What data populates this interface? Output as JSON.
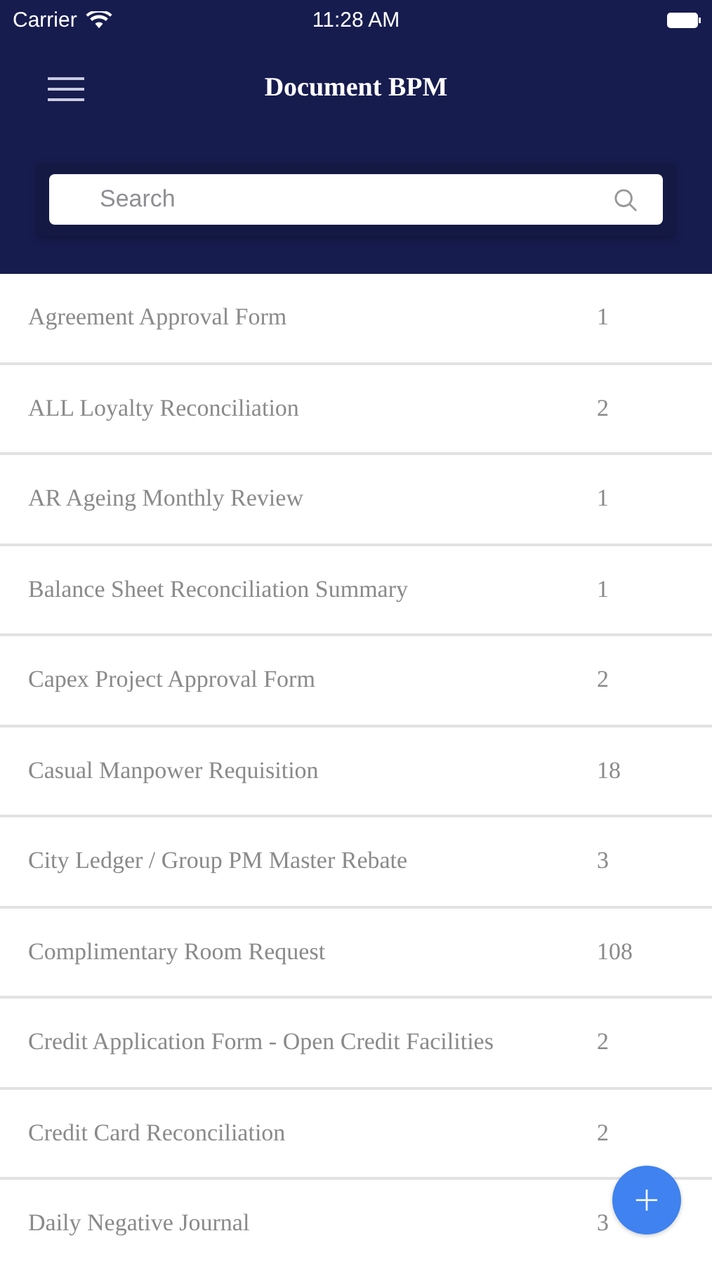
{
  "status_bar": {
    "carrier": "Carrier",
    "time": "11:28 AM"
  },
  "header": {
    "title": "Document BPM"
  },
  "search": {
    "placeholder": "Search"
  },
  "documents": [
    {
      "name": "Agreement Approval Form",
      "count": "1"
    },
    {
      "name": "ALL Loyalty Reconciliation",
      "count": "2"
    },
    {
      "name": "AR Ageing Monthly Review",
      "count": "1"
    },
    {
      "name": "Balance Sheet Reconciliation Summary",
      "count": "1"
    },
    {
      "name": "Capex Project Approval Form",
      "count": "2"
    },
    {
      "name": "Casual Manpower Requisition",
      "count": "18"
    },
    {
      "name": "City Ledger / Group PM Master Rebate",
      "count": "3"
    },
    {
      "name": "Complimentary Room Request",
      "count": "108"
    },
    {
      "name": "Credit Application Form - Open Credit Facilities",
      "count": "2"
    },
    {
      "name": "Credit Card Reconciliation",
      "count": "2"
    },
    {
      "name": "Daily Negative Journal",
      "count": "3"
    }
  ]
}
